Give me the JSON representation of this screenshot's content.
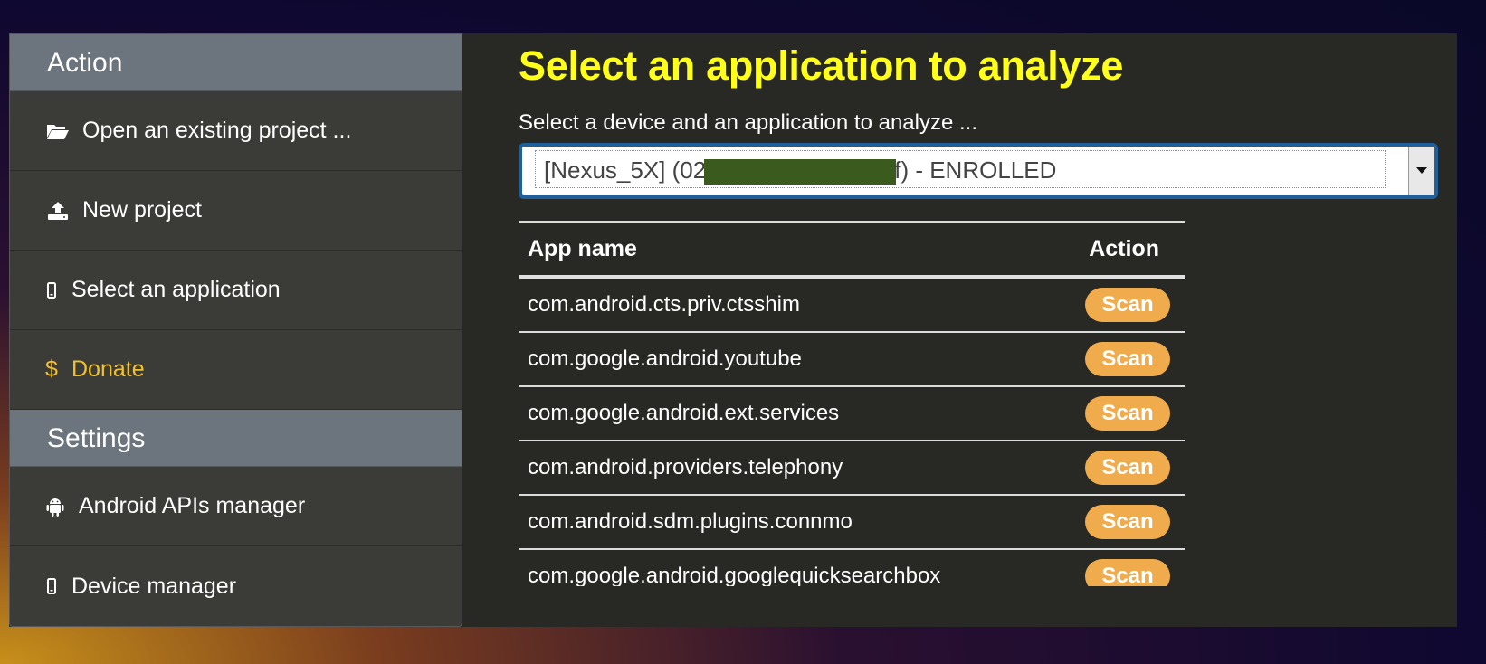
{
  "sidebar": {
    "action_header": "Action",
    "action_items": [
      {
        "label": "Open an existing project ...",
        "icon": "folder-open-icon"
      },
      {
        "label": "New project",
        "icon": "upload-icon"
      },
      {
        "label": "Select an application",
        "icon": "mobile-icon"
      },
      {
        "label": "Donate",
        "icon": "dollar-icon"
      }
    ],
    "settings_header": "Settings",
    "settings_items": [
      {
        "label": "Android APIs manager",
        "icon": "android-icon"
      },
      {
        "label": "Device manager",
        "icon": "mobile-icon"
      }
    ]
  },
  "main": {
    "title": "Select an application to analyze",
    "subtitle": "Select a device and an application to analyze ...",
    "device_select": {
      "value_prefix": "[Nexus_5X] (02",
      "value_suffix": "f) - ENROLLED"
    },
    "table": {
      "headers": {
        "app_name": "App name",
        "action": "Action"
      },
      "rows": [
        {
          "app_name": "com.android.cts.priv.ctsshim",
          "action": "Scan"
        },
        {
          "app_name": "com.google.android.youtube",
          "action": "Scan"
        },
        {
          "app_name": "com.google.android.ext.services",
          "action": "Scan"
        },
        {
          "app_name": "com.android.providers.telephony",
          "action": "Scan"
        },
        {
          "app_name": "com.android.sdm.plugins.connmo",
          "action": "Scan"
        },
        {
          "app_name": "com.google.android.googlequicksearchbox",
          "action": "Scan"
        }
      ]
    }
  },
  "colors": {
    "title": "#ffff1a",
    "donate": "#f2c12e",
    "scan_button": "#f0ac4c",
    "sidebar_header": "#6c757d",
    "select_border": "#1f5f9c"
  }
}
